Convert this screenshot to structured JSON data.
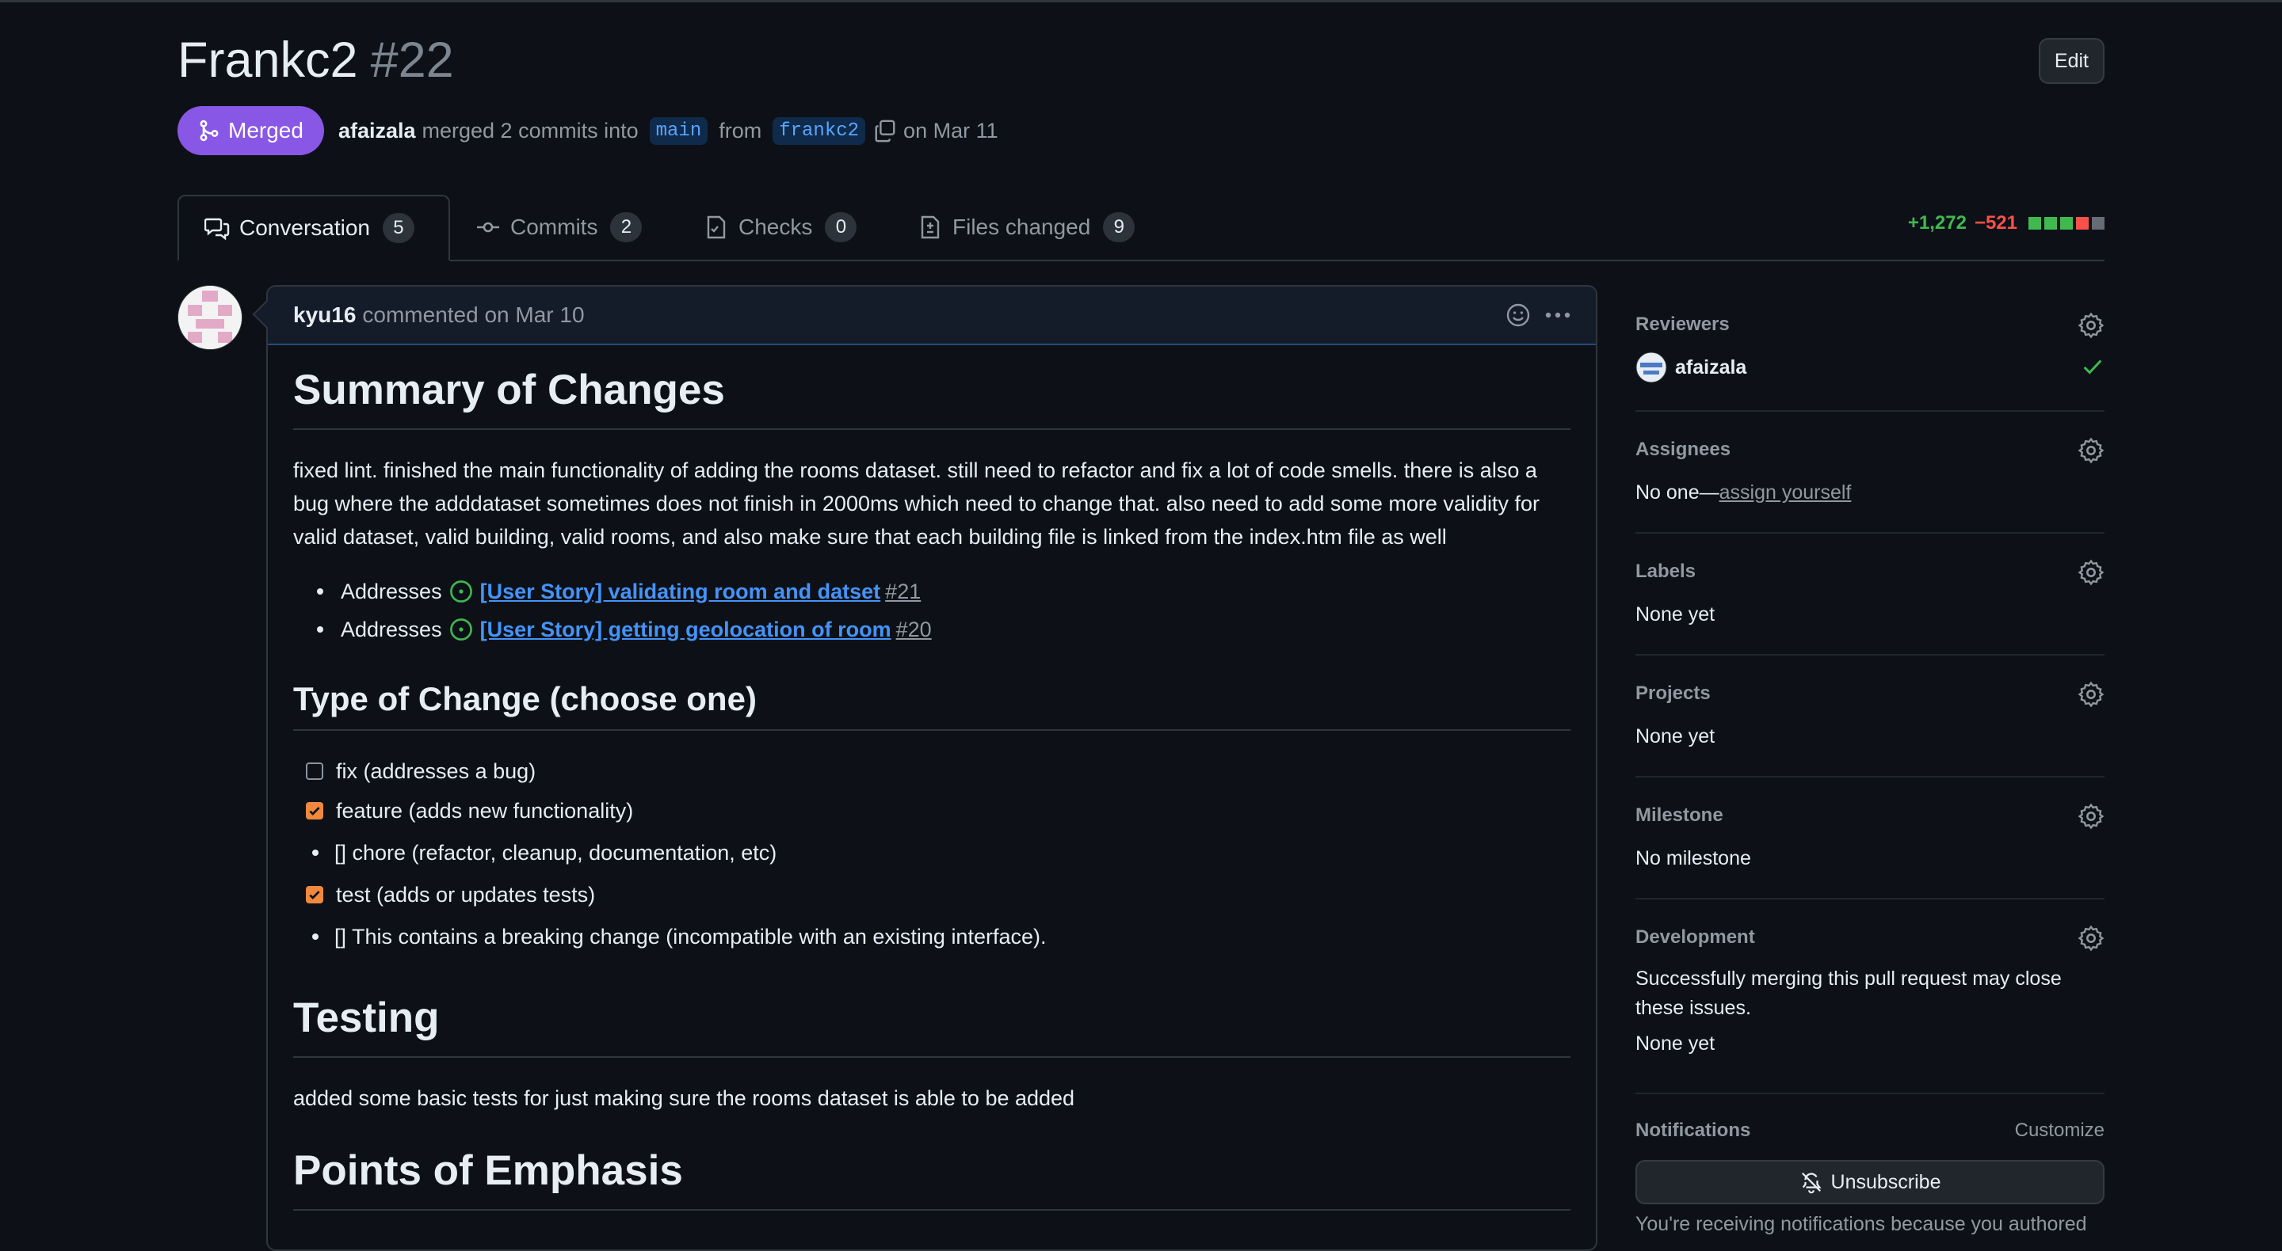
{
  "header": {
    "title": "Frankc2",
    "number": "#22",
    "edit_label": "Edit",
    "state_label": "Merged",
    "author": "afaizala",
    "merge_text": "merged 2 commits into",
    "base_branch": "main",
    "from_text": "from",
    "head_branch": "frankc2",
    "date_text": "on Mar 11"
  },
  "tabs": [
    {
      "label": "Conversation",
      "count": "5",
      "icon": "comment-discussion-icon"
    },
    {
      "label": "Commits",
      "count": "2",
      "icon": "git-commit-icon"
    },
    {
      "label": "Checks",
      "count": "0",
      "icon": "checklist-icon"
    },
    {
      "label": "Files changed",
      "count": "9",
      "icon": "file-diff-icon"
    }
  ],
  "diffstat": {
    "additions": "+1,272",
    "deletions": "−521",
    "colors": [
      "#3fb950",
      "#3fb950",
      "#3fb950",
      "#f85149",
      "#656c76"
    ]
  },
  "comment": {
    "author": "kyu16",
    "meta": "commented on Mar 10",
    "h1_summary": "Summary of Changes",
    "summary_text": "fixed lint. finished the main functionality of adding the rooms dataset. still need to refactor and fix a lot of code smells. there is also a bug where the adddataset sometimes does not finish in 2000ms which need to change that. also need to add some more validity for valid dataset, valid building, valid rooms, and also make sure that each building file is linked from the index.htm file as well",
    "addresses": [
      {
        "prefix": "Addresses",
        "title": "[User Story] validating room and datset",
        "number": "#21"
      },
      {
        "prefix": "Addresses",
        "title": "[User Story] getting geolocation of room",
        "number": "#20"
      }
    ],
    "h2_type": "Type of Change (choose one)",
    "type_items": [
      {
        "kind": "checkbox",
        "checked": false,
        "text": "fix (addresses a bug)"
      },
      {
        "kind": "checkbox",
        "checked": true,
        "text": "feature (adds new functionality)"
      },
      {
        "kind": "bullet",
        "text": "[] chore (refactor, cleanup, documentation, etc)"
      },
      {
        "kind": "checkbox",
        "checked": true,
        "text": "test (adds or updates tests)"
      },
      {
        "kind": "bullet",
        "text": "[] This contains a breaking change (incompatible with an existing interface)."
      }
    ],
    "h1_testing": "Testing",
    "testing_text": "added some basic tests for just making sure the rooms dataset is able to be added",
    "h1_partial": "Points of Emphasis"
  },
  "sidebar": {
    "reviewers": {
      "title": "Reviewers",
      "name": "afaizala"
    },
    "assignees": {
      "title": "Assignees",
      "value": "No one—",
      "link": "assign yourself"
    },
    "labels": {
      "title": "Labels",
      "value": "None yet"
    },
    "projects": {
      "title": "Projects",
      "value": "None yet"
    },
    "milestone": {
      "title": "Milestone",
      "value": "No milestone"
    },
    "development": {
      "title": "Development",
      "desc": "Successfully merging this pull request may close these issues.",
      "value": "None yet"
    },
    "notifications": {
      "title": "Notifications",
      "customize": "Customize",
      "button": "Unsubscribe",
      "note": "You're receiving notifications because you authored"
    }
  }
}
